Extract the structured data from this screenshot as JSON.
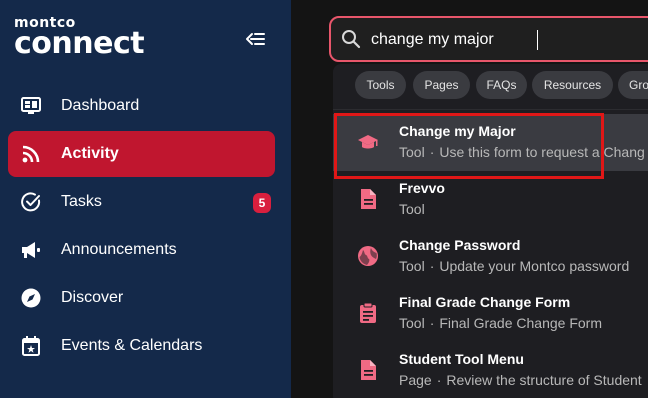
{
  "brand": {
    "logo_top": "montco",
    "logo_bottom": "connect"
  },
  "sidebar": {
    "items": [
      {
        "label": "Dashboard",
        "icon": "dashboard-icon"
      },
      {
        "label": "Activity",
        "icon": "rss-icon",
        "active": true
      },
      {
        "label": "Tasks",
        "icon": "check-circle-icon",
        "badge": "5"
      },
      {
        "label": "Announcements",
        "icon": "megaphone-icon"
      },
      {
        "label": "Discover",
        "icon": "compass-icon"
      },
      {
        "label": "Events & Calendars",
        "icon": "calendar-icon"
      }
    ]
  },
  "search": {
    "value": "change my major"
  },
  "filters": [
    "Tools",
    "Pages",
    "FAQs",
    "Resources",
    "Gro"
  ],
  "results": [
    {
      "title": "Change my Major",
      "type": "Tool",
      "desc": "Use this form to request a Chang",
      "icon": "graduation-cap-icon"
    },
    {
      "title": "Frevvo",
      "type": "Tool",
      "desc": "",
      "icon": "document-icon"
    },
    {
      "title": "Change Password",
      "type": "Tool",
      "desc": "Update your Montco password",
      "icon": "globe-icon"
    },
    {
      "title": "Final Grade Change Form",
      "type": "Tool",
      "desc": "Final Grade Change Form",
      "icon": "clipboard-icon"
    },
    {
      "title": "Student Tool Menu",
      "type": "Page",
      "desc": "Review the structure of Student",
      "icon": "document-icon"
    }
  ],
  "colors": {
    "accent": "#c0162f",
    "sidebar_bg": "#14294a",
    "icon_pink": "#f06a84",
    "highlight_outline": "#e01717"
  }
}
